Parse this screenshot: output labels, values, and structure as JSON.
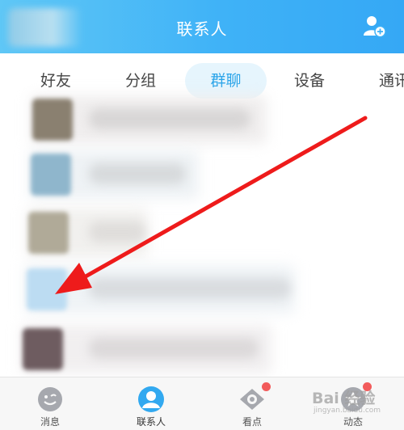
{
  "header": {
    "title": "联系人",
    "add_icon": "add-contact-icon"
  },
  "tabs": [
    {
      "label": "好友",
      "active": false
    },
    {
      "label": "分组",
      "active": false
    },
    {
      "label": "群聊",
      "active": true
    },
    {
      "label": "设备",
      "active": false
    },
    {
      "label": "通讯录",
      "active": false
    }
  ],
  "list_items": [
    {
      "avatar_color": "#8a8070",
      "blurred": true
    },
    {
      "avatar_color": "#8fb6cc",
      "blurred": true
    },
    {
      "avatar_color": "#b0aa98",
      "blurred": true
    },
    {
      "avatar_color": "#bcdcf2",
      "blurred": true
    },
    {
      "avatar_color": "#6e5c60",
      "blurred": true
    }
  ],
  "annotation": {
    "type": "arrow",
    "color": "#ee1b1b"
  },
  "bottom_nav": [
    {
      "label": "消息",
      "icon": "message-icon",
      "active": false,
      "badge": false
    },
    {
      "label": "联系人",
      "icon": "contacts-icon",
      "active": true,
      "badge": false
    },
    {
      "label": "看点",
      "icon": "eye-icon",
      "active": false,
      "badge": true
    },
    {
      "label": "动态",
      "icon": "star-icon",
      "active": false,
      "badge": true
    }
  ],
  "watermark": {
    "text": "Bai 经验",
    "subtext": "jingyan.baidu.com"
  }
}
